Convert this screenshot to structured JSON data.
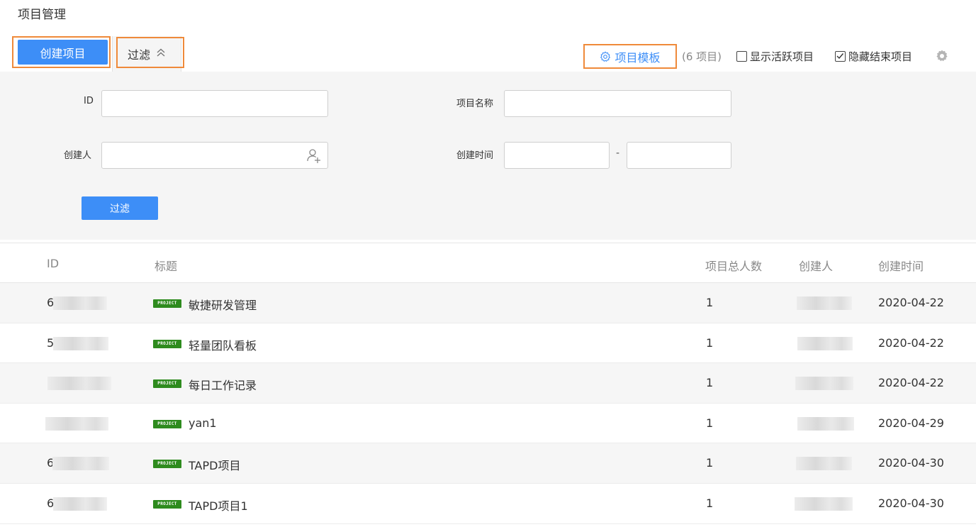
{
  "page": {
    "title": "项目管理"
  },
  "toolbar": {
    "create_label": "创建项目",
    "filter_tab_label": "过滤",
    "template_label": "项目模板",
    "count_text": "(6 项目)",
    "show_active_label": "显示活跃项目",
    "show_active_checked": false,
    "hide_closed_label": "隐藏结束项目",
    "hide_closed_checked": true
  },
  "filter": {
    "id_label": "ID",
    "id_value": "",
    "name_label": "项目名称",
    "name_value": "",
    "creator_label": "创建人",
    "creator_value": "",
    "created_time_label": "创建时间",
    "date_from": "",
    "date_separator": "-",
    "date_to": "",
    "submit_label": "过滤"
  },
  "table": {
    "columns": {
      "id": "ID",
      "title": "标题",
      "members": "项目总人数",
      "creator": "创建人",
      "created": "创建时间"
    },
    "badge_text": "PROJECT",
    "rows": [
      {
        "id": "6",
        "title": "敏捷研发管理",
        "members": "1",
        "created": "2020-04-22"
      },
      {
        "id": "5",
        "title": "轻量团队看板",
        "members": "1",
        "created": "2020-04-22"
      },
      {
        "id": "",
        "title": "每日工作记录",
        "members": "1",
        "created": "2020-04-22"
      },
      {
        "id": "",
        "title": "yan1",
        "members": "1",
        "created": "2020-04-29"
      },
      {
        "id": "6",
        "title": "TAPD项目",
        "members": "1",
        "created": "2020-04-30"
      },
      {
        "id": "6",
        "title": "TAPD项目1",
        "members": "1",
        "created": "2020-04-30"
      }
    ]
  },
  "colors": {
    "primary": "#3d8ef7",
    "highlight": "#ef8a3a",
    "badge": "#2e8b1e"
  }
}
